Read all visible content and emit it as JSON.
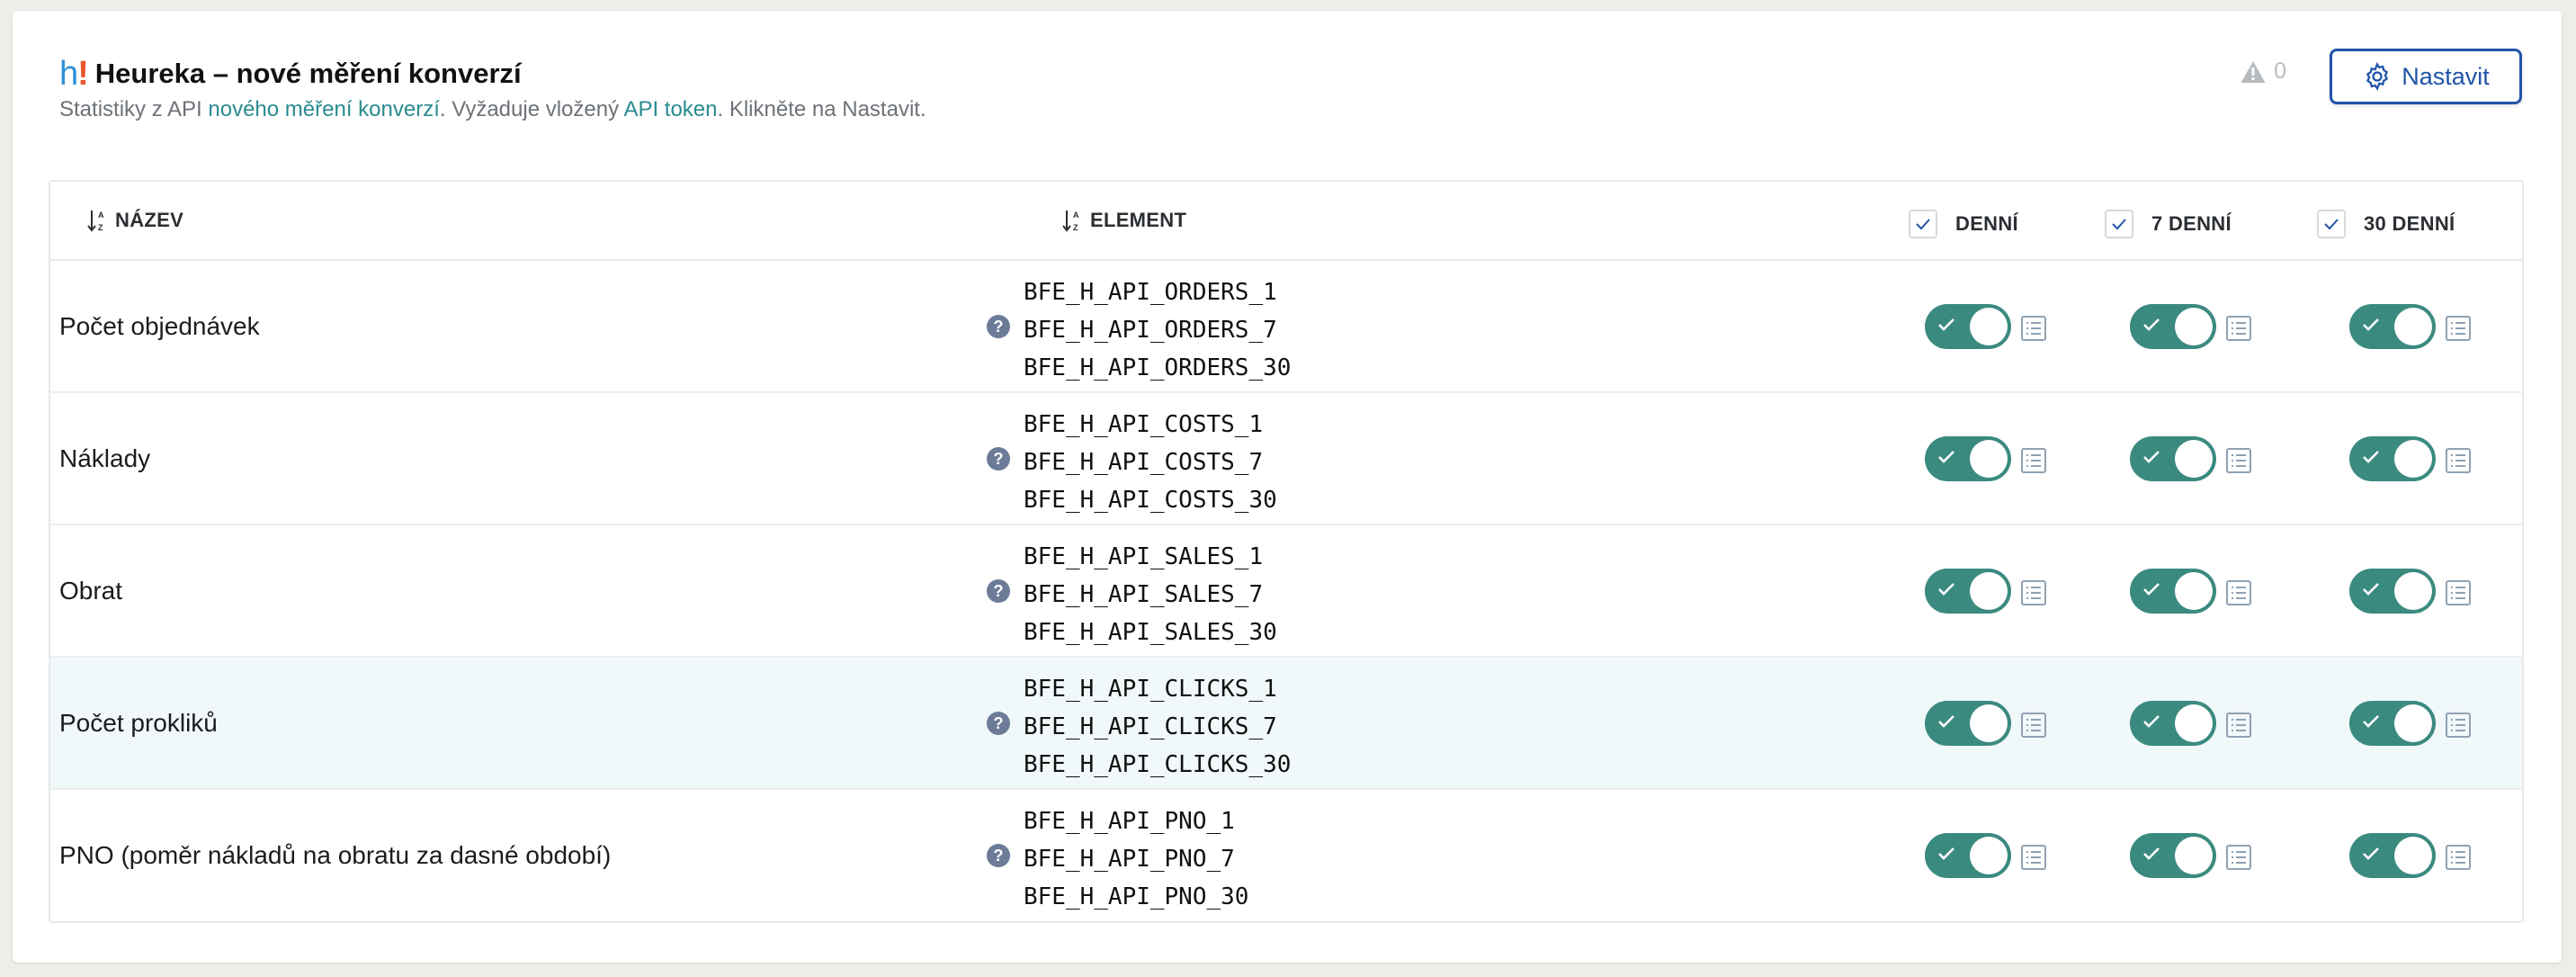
{
  "header": {
    "title": "Heureka – nové měření konverzí",
    "subtitle": {
      "part1": "Statistiky z API ",
      "link1": "nového měření konverzí",
      "part2": ". Vyžaduje vložený ",
      "link2": "API token",
      "part3": ". Klikněte na Nastavit."
    },
    "warning_count": "0",
    "settings_button": "Nastavit"
  },
  "table": {
    "columns": {
      "name": "NÁZEV",
      "element": "ELEMENT",
      "daily": "DENNÍ",
      "weekly": "7 DENNÍ",
      "monthly": "30 DENNÍ"
    },
    "rows": [
      {
        "name": "Počet objednávek",
        "elements": [
          "BFE_H_API_ORDERS_1",
          "BFE_H_API_ORDERS_7",
          "BFE_H_API_ORDERS_30"
        ],
        "enabled": [
          true,
          true,
          true
        ]
      },
      {
        "name": "Náklady",
        "elements": [
          "BFE_H_API_COSTS_1",
          "BFE_H_API_COSTS_7",
          "BFE_H_API_COSTS_30"
        ],
        "enabled": [
          true,
          true,
          true
        ]
      },
      {
        "name": "Obrat",
        "elements": [
          "BFE_H_API_SALES_1",
          "BFE_H_API_SALES_7",
          "BFE_H_API_SALES_30"
        ],
        "enabled": [
          true,
          true,
          true
        ]
      },
      {
        "name": "Počet prokliků",
        "elements": [
          "BFE_H_API_CLICKS_1",
          "BFE_H_API_CLICKS_7",
          "BFE_H_API_CLICKS_30"
        ],
        "enabled": [
          true,
          true,
          true
        ]
      },
      {
        "name": "PNO (poměr nákladů na obratu za dasné období)",
        "elements": [
          "BFE_H_API_PNO_1",
          "BFE_H_API_PNO_7",
          "BFE_H_API_PNO_30"
        ],
        "enabled": [
          true,
          true,
          true
        ]
      }
    ]
  },
  "colors": {
    "toggle_on": "#3b8a80",
    "link": "#2a8b90",
    "button_border": "#2054a8",
    "highlight_row": "#f1f8fa"
  },
  "icons": [
    "heureka-logo",
    "warning-icon",
    "gear-icon",
    "sort-alpha-icon",
    "check-icon",
    "help-icon",
    "list-icon"
  ]
}
